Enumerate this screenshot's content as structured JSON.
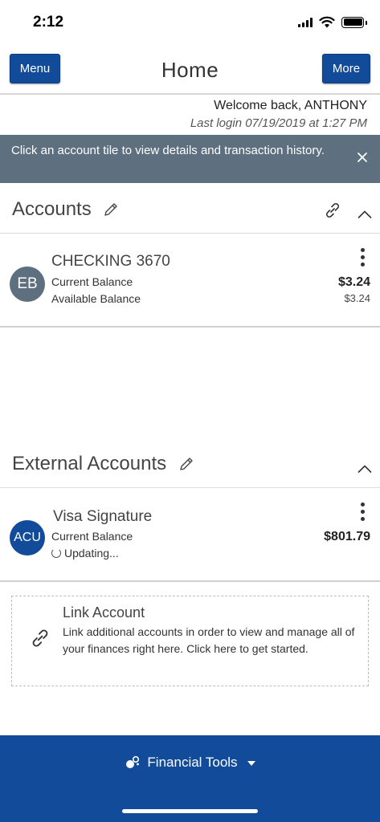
{
  "status_bar": {
    "time": "2:12"
  },
  "header": {
    "title": "Home",
    "menu_label": "Menu",
    "more_label": "More"
  },
  "welcome": {
    "greeting": "Welcome back, ANTHONY",
    "last_login": "Last login 07/19/2019 at 1:27 PM"
  },
  "banner": {
    "text": "Click an account tile to view details and transaction history."
  },
  "accounts_section": {
    "title": "Accounts",
    "items": [
      {
        "initials": "EB",
        "avatar_color": "#5e6f7f",
        "name": "CHECKING 3670",
        "current_label": "Current Balance",
        "current_value": "$3.24",
        "available_label": "Available Balance",
        "available_value": "$3.24"
      }
    ]
  },
  "external_section": {
    "title": "External Accounts",
    "items": [
      {
        "initials": "ACU",
        "avatar_color": "#124b99",
        "name": "Visa Signature",
        "current_label": "Current Balance",
        "current_value": "$801.79",
        "status": "Updating..."
      }
    ]
  },
  "link_account": {
    "title": "Link Account",
    "description": "Link additional accounts in order to view and manage all of your finances right here. Click here to get started."
  },
  "footer": {
    "label": "Financial Tools"
  },
  "colors": {
    "brand_blue": "#124b99",
    "banner_gray": "#5e6f7f"
  }
}
